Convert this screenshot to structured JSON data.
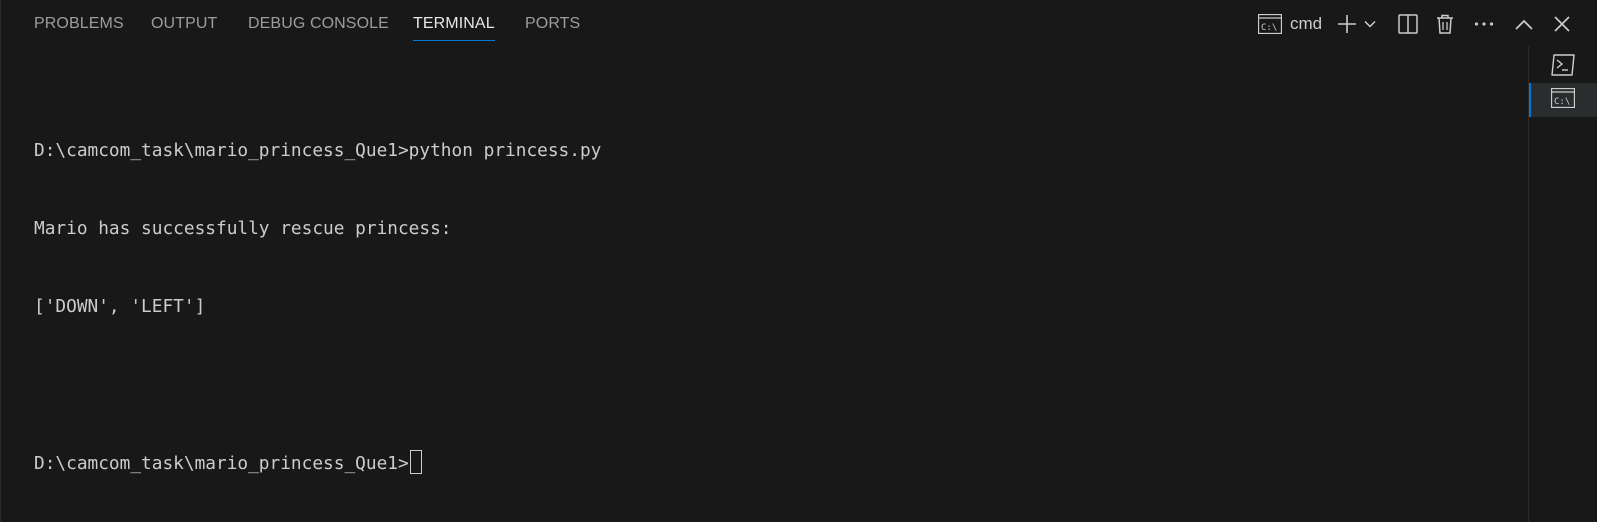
{
  "tabs": [
    {
      "label": "PROBLEMS",
      "active": false
    },
    {
      "label": "OUTPUT",
      "active": false
    },
    {
      "label": "DEBUG CONSOLE",
      "active": false
    },
    {
      "label": "TERMINAL",
      "active": true
    },
    {
      "label": "PORTS",
      "active": false
    }
  ],
  "toolbar": {
    "shell_label": "cmd",
    "shell_icon": "cmd-terminal-icon",
    "icons": [
      "plus-icon",
      "chevron-down-icon",
      "split-icon",
      "trash-icon",
      "ellipsis-icon",
      "chevron-up-icon",
      "close-icon"
    ]
  },
  "terminal": {
    "lines": [
      "D:\\camcom_task\\mario_princess_Que1>python princess.py",
      "Mario has successfully rescue princess:",
      "['DOWN', 'LEFT']",
      "",
      "D:\\camcom_task\\mario_princess_Que1>"
    ]
  },
  "side_terminals": [
    {
      "icon": "powershell-icon",
      "active": false
    },
    {
      "icon": "cmd-terminal-icon",
      "active": true
    }
  ],
  "colors": {
    "background": "#181818",
    "text": "#cccccc",
    "accent": "#0078d4",
    "inactive_tab": "#9d9d9d"
  }
}
